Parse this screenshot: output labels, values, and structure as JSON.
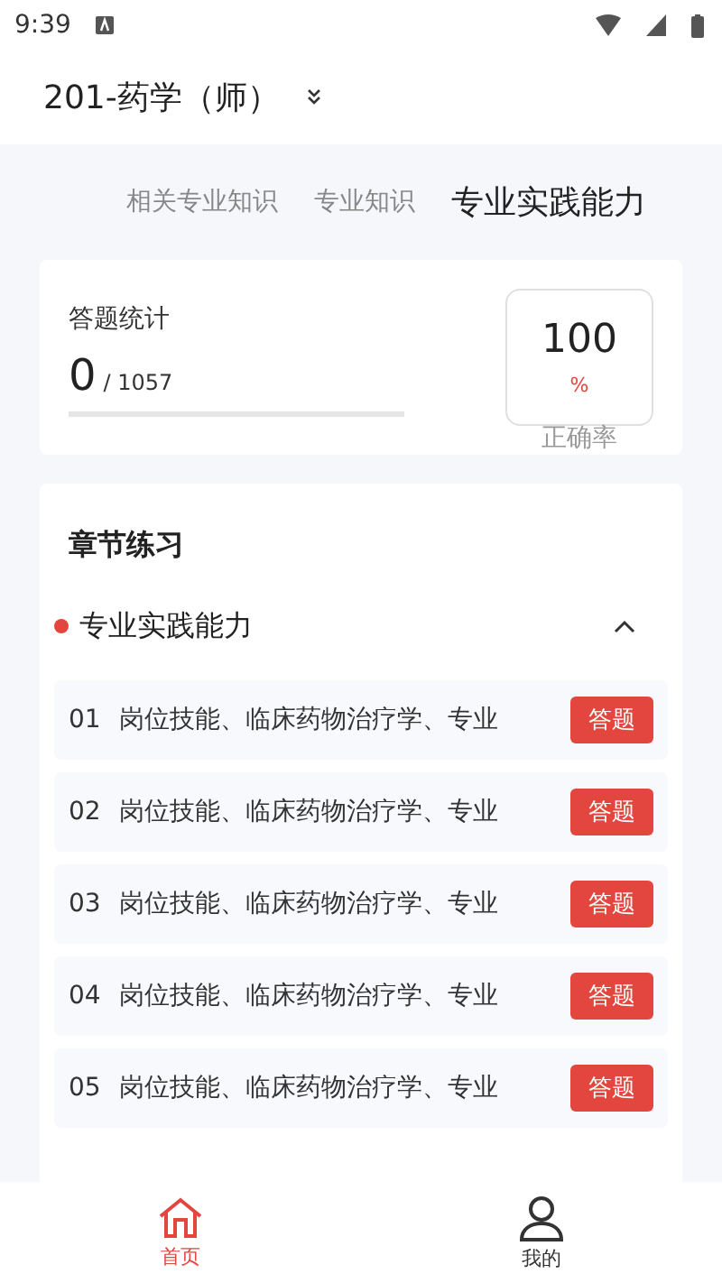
{
  "status_bar": {
    "time": "9:39"
  },
  "header": {
    "title": "201-药学（师）"
  },
  "tabs": [
    {
      "label": "相关专业知识",
      "selected": false
    },
    {
      "label": "专业知识",
      "selected": false
    },
    {
      "label": "专业实践能力",
      "selected": true
    }
  ],
  "stats": {
    "title": "答题统计",
    "done": "0",
    "total": "/ 1057",
    "level": 0,
    "accuracy": "100",
    "unit": "%",
    "accuracy_label": "正确率"
  },
  "chapters": {
    "title": "章节练习",
    "section": {
      "title": "专业实践能力",
      "expanded": true,
      "items": [
        {
          "number": "01",
          "title": "岗位技能、临床药物治疗学、专业",
          "action": "答题"
        },
        {
          "number": "02",
          "title": "岗位技能、临床药物治疗学、专业",
          "action": "答题"
        },
        {
          "number": "03",
          "title": "岗位技能、临床药物治疗学、专业",
          "action": "答题"
        },
        {
          "number": "04",
          "title": "岗位技能、临床药物治疗学、专业",
          "action": "答题"
        },
        {
          "number": "05",
          "title": "岗位技能、临床药物治疗学、专业",
          "action": "答题"
        }
      ]
    }
  },
  "nav": [
    {
      "label": "首页",
      "kind": "home",
      "selected": true
    },
    {
      "label": "我的",
      "kind": "profile",
      "selected": false
    }
  ]
}
